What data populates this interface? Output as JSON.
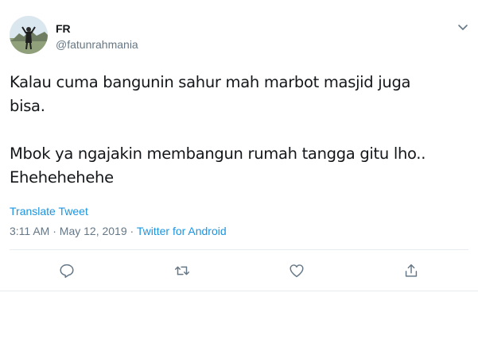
{
  "author": {
    "name": "FR",
    "handle": "@fatunrahmania"
  },
  "tweet": {
    "text": "Kalau cuma bangunin sahur mah marbot masjid juga\nbisa.\n\nMbok ya ngajakin membangun rumah tangga gitu lho..\nEhehehehehe",
    "translate_label": "Translate Tweet",
    "time": "3:11 AM",
    "separator1": " · ",
    "date": "May 12, 2019",
    "separator2": " · ",
    "source": "Twitter for Android"
  },
  "icons": {
    "caret": "chevron-down-icon",
    "reply": "reply-icon",
    "retweet": "retweet-icon",
    "like": "heart-icon",
    "share": "share-icon"
  },
  "colors": {
    "link": "#1b95e0",
    "secondary": "#657786",
    "text": "#14171a",
    "divider": "#e6ecf0"
  }
}
